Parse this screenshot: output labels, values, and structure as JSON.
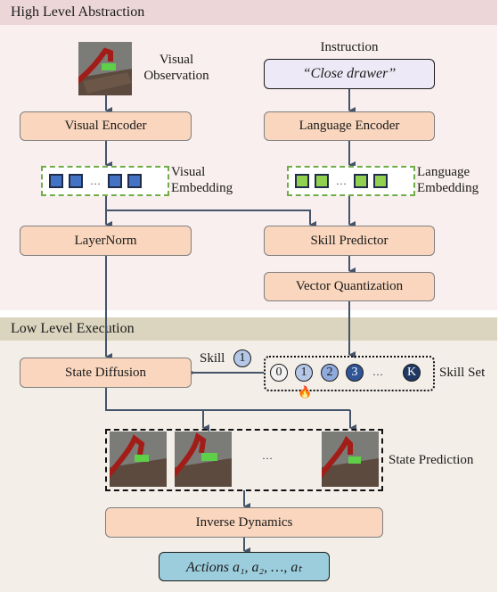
{
  "high_level": {
    "title": "High Level Abstraction",
    "visual_observation_label_line1": "Visual",
    "visual_observation_label_line2": "Observation",
    "instruction_label": "Instruction",
    "instruction_text": "“Close drawer”",
    "visual_encoder": "Visual Encoder",
    "language_encoder": "Language Encoder",
    "visual_embedding_line1": "Visual",
    "visual_embedding_line2": "Embedding",
    "language_embedding_line1": "Language",
    "language_embedding_line2": "Embedding",
    "embedding_ellipsis": "…",
    "layernorm": "LayerNorm",
    "skill_predictor": "Skill Predictor",
    "vector_quantization": "Vector Quantization"
  },
  "low_level": {
    "title": "Low Level Execution",
    "state_diffusion": "State Diffusion",
    "skill_label": "Skill",
    "selected_skill": "1",
    "skill_set_label": "Skill Set",
    "skills": [
      {
        "id": "0",
        "fill": "#f2f2f2",
        "text_color": "#1b1b1b"
      },
      {
        "id": "1",
        "fill": "#b4c7e7",
        "text_color": "#1b1b1b"
      },
      {
        "id": "2",
        "fill": "#8faadc",
        "text_color": "#1b1b1b"
      },
      {
        "id": "3",
        "fill": "#2f5597",
        "text_color": "#ffffff"
      },
      {
        "id": "K",
        "fill": "#1f3864",
        "text_color": "#ffffff"
      }
    ],
    "skills_ellipsis": "…",
    "fire_icon": "🔥",
    "state_prediction_label": "State Prediction",
    "frames_ellipsis": "…",
    "inverse_dynamics": "Inverse Dynamics",
    "actions": "Actions a₁, a₂, …, aₜ"
  },
  "colors": {
    "module_fill": "#f9d6bd",
    "arrow": "#44546a",
    "embedding_border": "#70ad47",
    "visual_token": "#4472c4",
    "language_token": "#92d050"
  }
}
